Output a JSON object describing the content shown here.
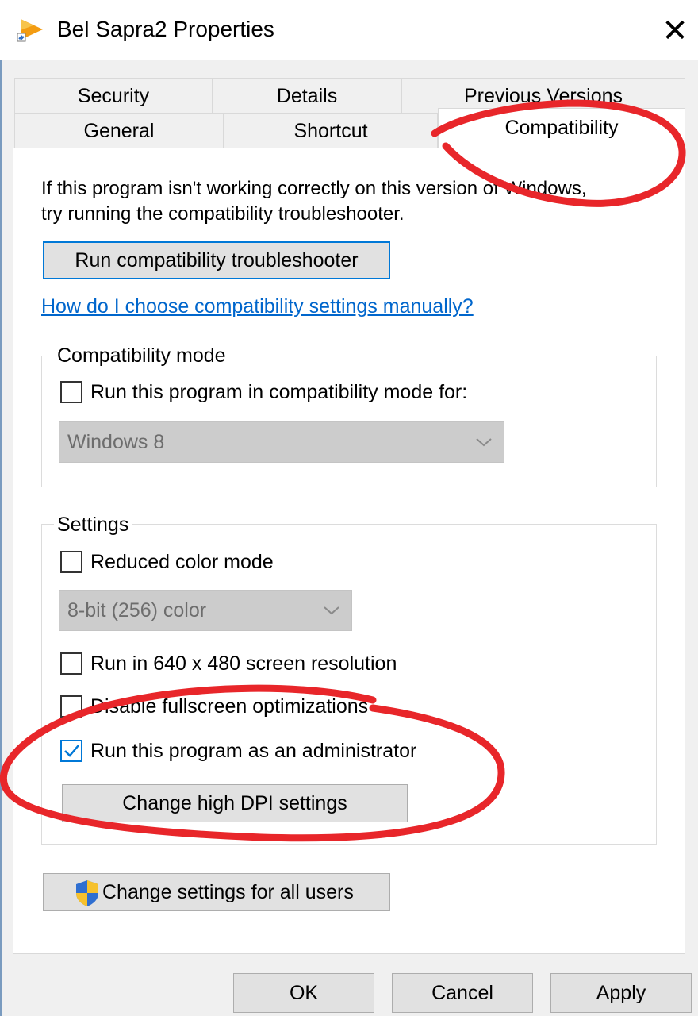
{
  "window": {
    "title": "Bel Sapra2 Properties",
    "close_glyph": "✕",
    "app_icon": "media-player-icon"
  },
  "tabs": {
    "row_back": [
      {
        "label": "Security"
      },
      {
        "label": "Details"
      },
      {
        "label": "Previous Versions"
      }
    ],
    "row_front": [
      {
        "label": "General"
      },
      {
        "label": "Shortcut"
      },
      {
        "label": "Compatibility",
        "active": true
      }
    ]
  },
  "compat": {
    "intro_line1": "If this program isn't working correctly on this version of Windows,",
    "intro_line2": "try running the compatibility troubleshooter.",
    "run_troubleshooter": "Run compatibility troubleshooter",
    "manual_link": "How do I choose compatibility settings manually?"
  },
  "compat_mode": {
    "legend": "Compatibility mode",
    "checkbox_label": "Run this program in compatibility mode for:",
    "checked": false,
    "os_value": "Windows 8"
  },
  "settings": {
    "legend": "Settings",
    "reduced_color": {
      "label": "Reduced color mode",
      "checked": false
    },
    "color_value": "8-bit (256) color",
    "res_640": {
      "label": "Run in 640 x 480 screen resolution",
      "checked": false
    },
    "disable_fullscreen": {
      "label": "Disable fullscreen optimizations",
      "checked": false
    },
    "run_admin": {
      "label": "Run this program as an administrator",
      "checked": true
    },
    "dpi_button": "Change high DPI settings"
  },
  "all_users_button": "Change settings for all users",
  "footer": {
    "ok": "OK",
    "cancel": "Cancel",
    "apply": "Apply"
  },
  "colors": {
    "accent": "#0078d7",
    "link": "#0066cc",
    "annotation": "#e8262a"
  }
}
